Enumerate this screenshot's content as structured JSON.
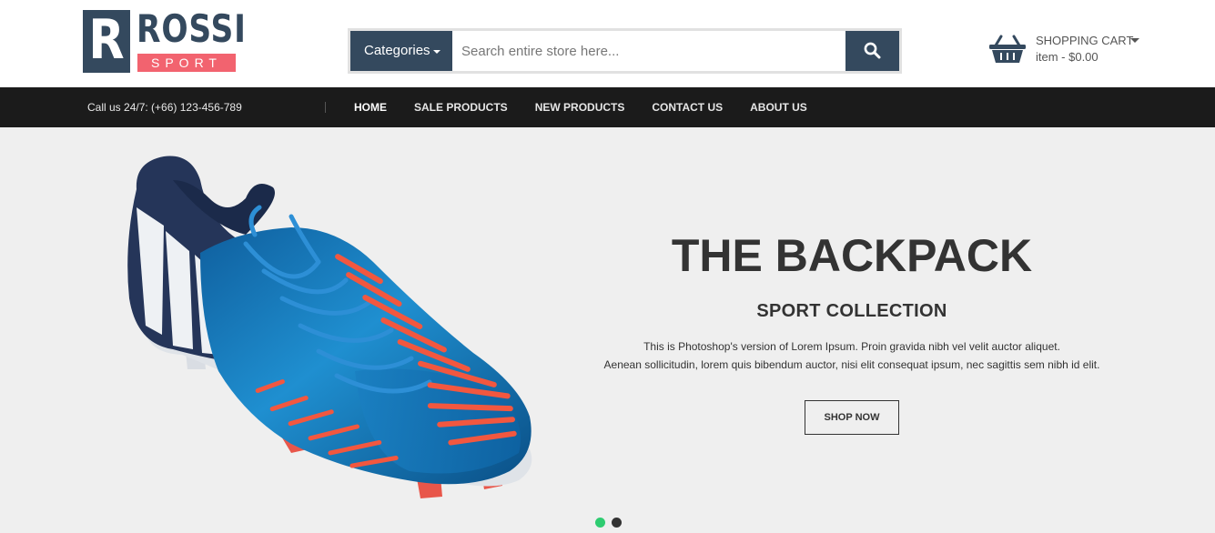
{
  "logo": {
    "mark": "R",
    "word": "ROSSI",
    "sub": "SPORT",
    "colors": {
      "dark": "#34495e",
      "accent": "#f2636f"
    }
  },
  "search": {
    "category_label": "Categories",
    "placeholder": "Search entire store here...",
    "button_icon": "search-icon"
  },
  "cart": {
    "icon": "shopping-basket-icon",
    "title": "SHOPPING CART",
    "summary": "item - $0.00"
  },
  "nav": {
    "phone": "Call us 24/7: (+66) 123-456-789",
    "links": [
      {
        "label": "HOME",
        "active": true
      },
      {
        "label": "SALE PRODUCTS",
        "active": false
      },
      {
        "label": "NEW PRODUCTS",
        "active": false
      },
      {
        "label": "CONTACT US",
        "active": false
      },
      {
        "label": "ABOUT US",
        "active": false
      }
    ]
  },
  "hero": {
    "title": "THE BACKPACK",
    "subtitle": "SPORT COLLECTION",
    "text_line1": "This is Photoshop's version of Lorem Ipsum. Proin gravida nibh vel velit auctor aliquet.",
    "text_line2": "Aenean sollicitudin, lorem quis bibendum auctor, nisi elit consequat ipsum, nec sagittis sem nibh id elit.",
    "button_label": "SHOP NOW",
    "image": "football-boot-image",
    "slides": {
      "count": 2,
      "active": 1,
      "active_color": "#2ecc71",
      "inactive_color": "#333333"
    }
  }
}
